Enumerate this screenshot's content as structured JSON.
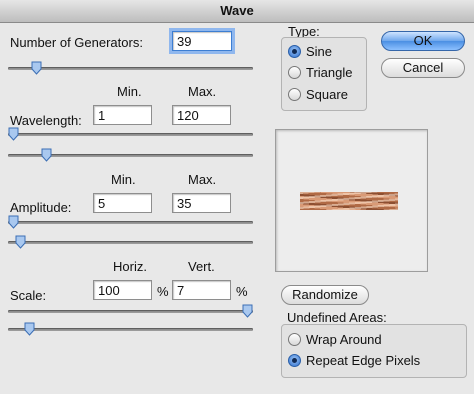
{
  "window": {
    "title": "Wave"
  },
  "generators": {
    "label": "Number of Generators:",
    "value": "39",
    "level": 0.1
  },
  "wavelength": {
    "label": "Wavelength:",
    "min_header": "Min.",
    "max_header": "Max.",
    "min_value": "1",
    "max_value": "120",
    "min_level": 0.0,
    "max_level": 0.14
  },
  "amplitude": {
    "label": "Amplitude:",
    "min_header": "Min.",
    "max_header": "Max.",
    "min_value": "5",
    "max_value": "35",
    "min_level": 0.0,
    "max_level": 0.03
  },
  "scale": {
    "label": "Scale:",
    "horiz_header": "Horiz.",
    "vert_header": "Vert.",
    "horiz_value": "100",
    "vert_value": "7",
    "unit": "%",
    "horiz_level": 1.0,
    "vert_level": 0.07
  },
  "type": {
    "label": "Type:",
    "options": [
      "Sine",
      "Triangle",
      "Square"
    ],
    "selected": "Sine"
  },
  "buttons": {
    "ok": "OK",
    "cancel": "Cancel",
    "randomize": "Randomize"
  },
  "undefined_areas": {
    "label": "Undefined Areas:",
    "options": [
      "Wrap Around",
      "Repeat Edge Pixels"
    ],
    "selected": "Repeat Edge Pixels"
  },
  "colors": {
    "accent": "#3d7ed2",
    "background": "#e8e8e8"
  },
  "icons": {
    "slider_thumb": "slider-thumb-icon"
  }
}
